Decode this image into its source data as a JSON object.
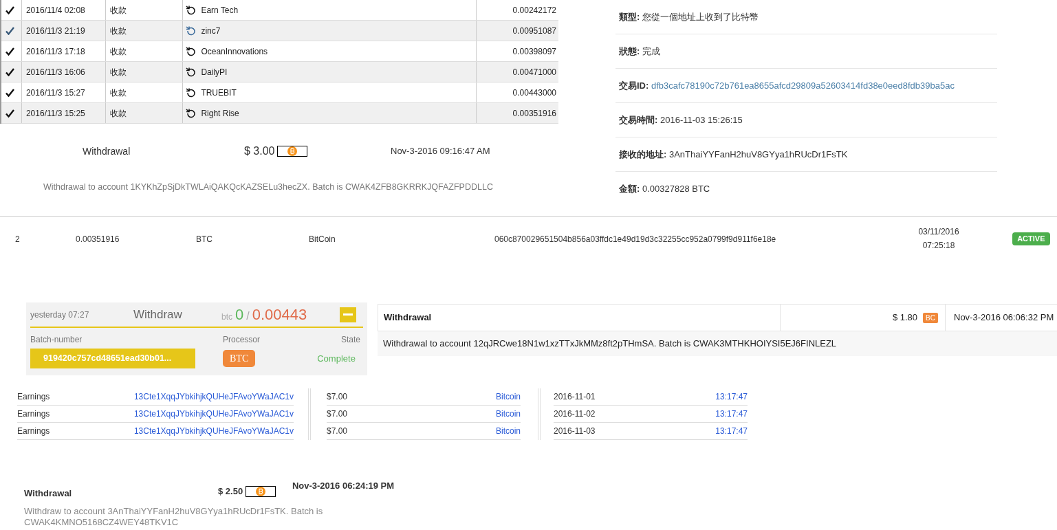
{
  "wallet_table": {
    "rows": [
      {
        "date": "2016/11/4 02:08",
        "type": "收款",
        "name": "Earn Tech",
        "amount": "0.00242172",
        "selected": false
      },
      {
        "date": "2016/11/3 21:19",
        "type": "收款",
        "name": "zinc7",
        "amount": "0.00951087",
        "selected": true
      },
      {
        "date": "2016/11/3 17:18",
        "type": "收款",
        "name": "OceanInnovations",
        "amount": "0.00398097",
        "selected": false
      },
      {
        "date": "2016/11/3 16:06",
        "type": "收款",
        "name": "DailyPI",
        "amount": "0.00471000",
        "selected": false
      },
      {
        "date": "2016/11/3 15:27",
        "type": "收款",
        "name": "TRUEBIT",
        "amount": "0.00443000",
        "selected": false
      },
      {
        "date": "2016/11/3 15:25",
        "type": "收款",
        "name": "Right Rise",
        "amount": "0.00351916",
        "selected": false
      }
    ]
  },
  "withdrawal_1": {
    "title": "Withdrawal",
    "amount": "$ 3.00",
    "date": "Nov-3-2016 09:16:47 AM",
    "note": "Withdrawal to account 1KYKhZpSjDkTWLAiQAKQcKAZSELu3hecZX. Batch is CWAK4ZFB8GKRRKJQFAZFPDDLLC"
  },
  "tx_details": [
    {
      "label": "類型:",
      "value": "您從一個地址上收到了比特幣",
      "kind": "text"
    },
    {
      "label": "狀態:",
      "value": "完成",
      "kind": "text"
    },
    {
      "label": "交易ID:",
      "value": "dfb3cafc78190c72b761ea8655afcd29809a52603414fd38e0eed8fdb39ba5ac",
      "kind": "link"
    },
    {
      "label": "交易時間:",
      "value": "2016-11-03 15:26:15",
      "kind": "text"
    },
    {
      "label": "接收的地址:",
      "value": "3AnThaiYYFanH2huV8GYya1hRUcDr1FsTK",
      "kind": "text"
    },
    {
      "label": "金額:",
      "value": "0.00327828 BTC",
      "kind": "text"
    }
  ],
  "deposit_row": {
    "cells": [
      "2",
      "0.00351916",
      "BTC",
      "BitCoin",
      "060c870029651504b856a03ffdc1e49d19d3c32255cc952a0799f9d911f6e18e"
    ],
    "date": "03/11/2016",
    "time": "07:25:18",
    "status": "ACTIVE"
  },
  "withdraw_card": {
    "time": "yesterday 07:27",
    "title": "Withdraw",
    "unit": "btc",
    "paid": "0",
    "separator": "/",
    "total": "0.00443",
    "headers": [
      "Batch-number",
      "Processor",
      "State"
    ],
    "batch": "919420c757cd48651ead30b01...",
    "processor": "BTC",
    "state": "Complete"
  },
  "withdrawal_2": {
    "title": "Withdrawal",
    "amount": "$ 1.80",
    "badge": "BC",
    "date": "Nov-3-2016 06:06:32 PM",
    "note": "Withdrawal to account 12qJRCwe18N1w1xzTTxJkMMz8ft2pTHmSA. Batch is CWAK3MTHKHOIYSI5EJ6FINLEZL"
  },
  "earnings": [
    {
      "rows": [
        [
          "Earnings",
          "13Cte1XqqJYbkihjkQUHeJFAvoYWaJAC1v"
        ],
        [
          "Earnings",
          "13Cte1XqqJYbkihjkQUHeJFAvoYWaJAC1v"
        ],
        [
          "Earnings",
          "13Cte1XqqJYbkihjkQUHeJFAvoYWaJAC1v"
        ]
      ]
    },
    {
      "rows": [
        [
          "$7.00",
          "Bitcoin"
        ],
        [
          "$7.00",
          "Bitcoin"
        ],
        [
          "$7.00",
          "Bitcoin"
        ]
      ]
    },
    {
      "rows": [
        [
          "2016-11-01",
          "13:17:47"
        ],
        [
          "2016-11-02",
          "13:17:47"
        ],
        [
          "2016-11-03",
          "13:17:47"
        ]
      ]
    }
  ],
  "withdrawal_3": {
    "title": "Withdrawal",
    "amount": "$ 2.50",
    "date": "Nov-3-2016 06:24:19 PM",
    "note": "Withdraw to account 3AnThaiYYFanH2huV8GYya1hRUcDr1FsTK. Batch is CWAK4KMNO5168CZ4WEY48TKV1C"
  }
}
